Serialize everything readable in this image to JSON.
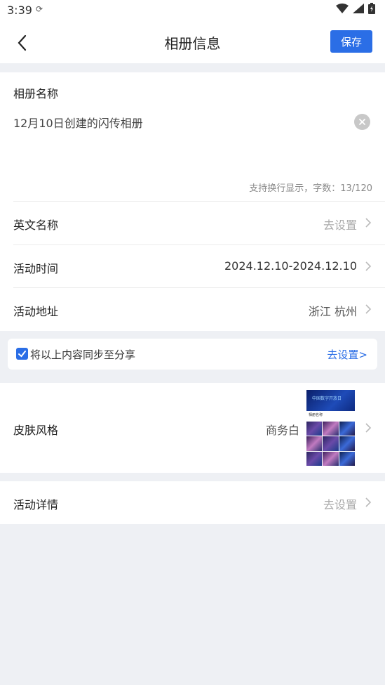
{
  "status_bar": {
    "time": "3:39",
    "sync_icon": "sync-icon",
    "icons": [
      "wifi-icon",
      "signal-icon",
      "battery-icon"
    ]
  },
  "header": {
    "title": "相册信息",
    "back_icon": "chevron-left-icon",
    "save_label": "保存"
  },
  "album_name": {
    "label": "相册名称",
    "value": "12月10日创建的闪传相册",
    "hint": "支持换行显示，字数：13/120",
    "clear_icon": "clear-icon"
  },
  "rows": {
    "english_name": {
      "label": "英文名称",
      "value": "去设置"
    },
    "activity_time": {
      "label": "活动时间",
      "value": "2024.12.10-2024.12.10"
    },
    "activity_address": {
      "label": "活动地址",
      "value": "浙江 杭州"
    }
  },
  "sync": {
    "checked": true,
    "text": "将以上内容同步至分享",
    "link": "去设置>"
  },
  "skin": {
    "label": "皮肤风格",
    "value": "商务白",
    "thumb_banner": "中国数字开放日",
    "thumb_info": "相册名称"
  },
  "activity_detail": {
    "label": "活动详情",
    "value": "去设置"
  },
  "colors": {
    "accent": "#2b6ee6",
    "background": "#eef0f4"
  }
}
